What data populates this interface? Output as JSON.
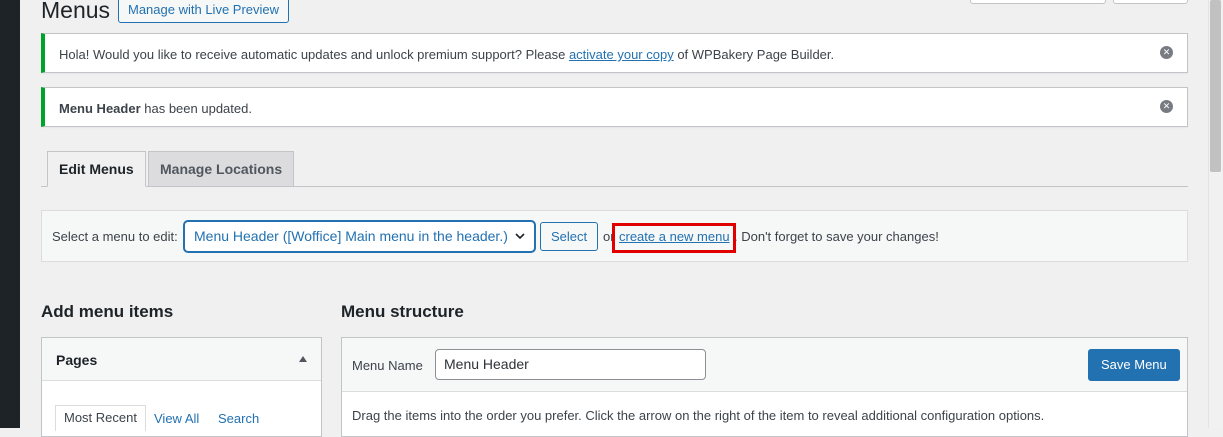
{
  "page": {
    "title": "Menus",
    "manage_live_preview": "Manage with Live Preview"
  },
  "notices": {
    "updates": {
      "text_before": "Hola! Would you like to receive automatic updates and unlock premium support? Please ",
      "link": "activate your copy",
      "text_after": " of WPBakery Page Builder."
    },
    "updated": {
      "bold": "Menu Header",
      "text": " has been updated."
    },
    "dismiss_glyph": "✕"
  },
  "tabs": [
    {
      "label": "Edit Menus",
      "active": true
    },
    {
      "label": "Manage Locations",
      "active": false
    }
  ],
  "select_menu": {
    "label": "Select a menu to edit:",
    "selected": "Menu Header ([Woffice] Main menu in the header.)",
    "button": "Select",
    "or": "or",
    "create_link": "create a new menu",
    "reminder": ". Don't forget to save your changes!",
    "highlight_color": "#e00000"
  },
  "add_items": {
    "heading": "Add menu items",
    "pages_title": "Pages",
    "sub_tabs": [
      "Most Recent",
      "View All",
      "Search"
    ]
  },
  "structure": {
    "heading": "Menu structure",
    "menu_name_label": "Menu Name",
    "menu_name_value": "Menu Header",
    "save_button": "Save Menu",
    "instructions": "Drag the items into the order you prefer. Click the arrow on the right of the item to reveal additional configuration options."
  },
  "colors": {
    "accent": "#2271b1",
    "notice_success": "#00a32a",
    "background": "#f0f0f1"
  }
}
